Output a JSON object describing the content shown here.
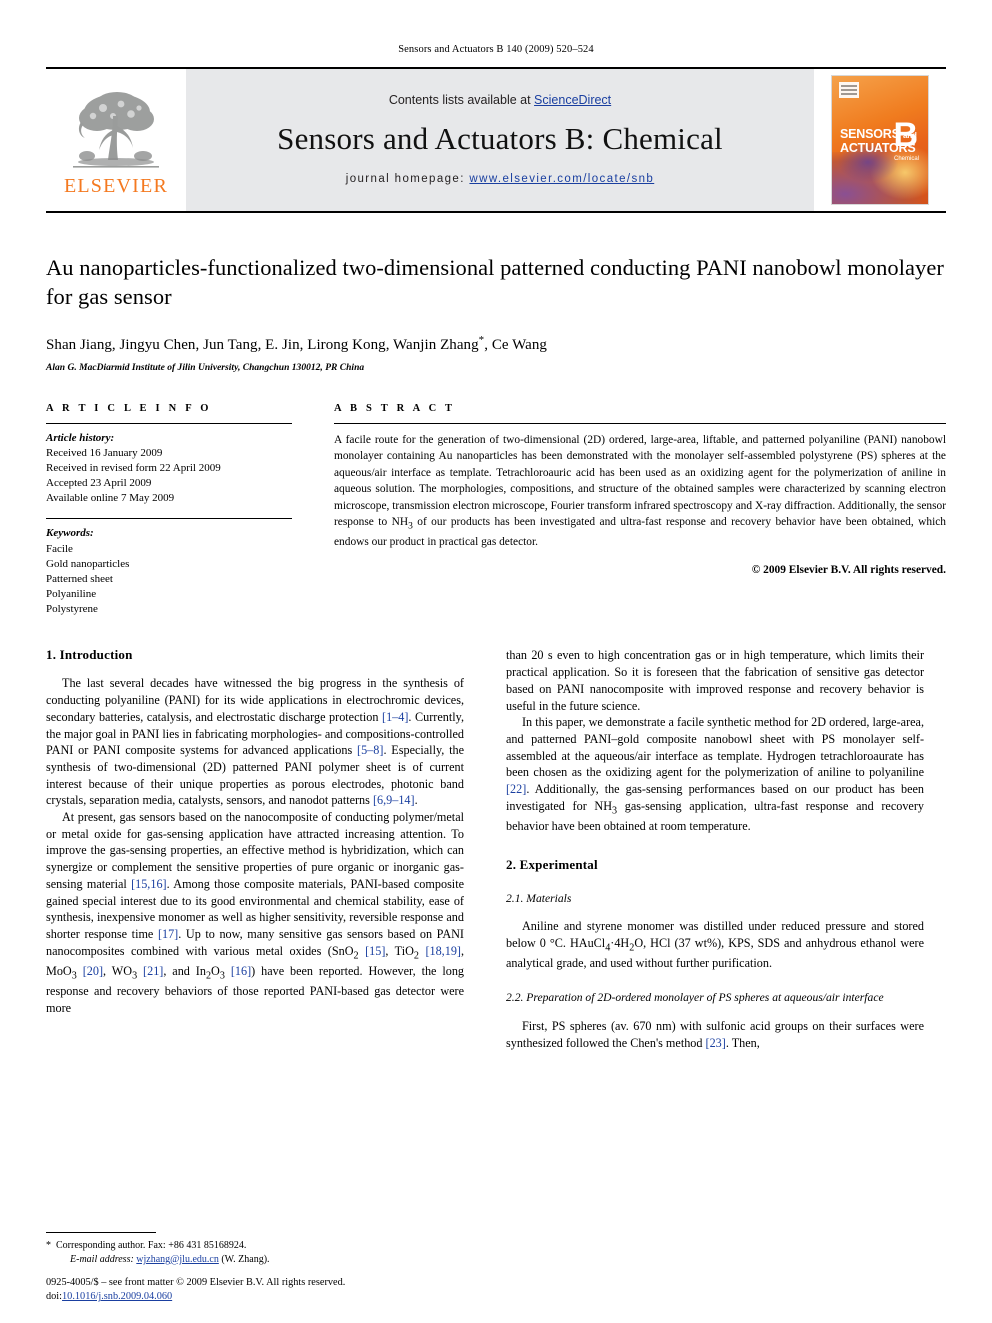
{
  "running_head": "Sensors and Actuators B 140 (2009) 520–524",
  "masthead": {
    "publisher_logo_label": "ELSEVIER",
    "contents_prefix": "Contents lists available at ",
    "contents_link": "ScienceDirect",
    "journal_title": "Sensors and Actuators B: Chemical",
    "homepage_prefix": "journal homepage: ",
    "homepage_url": "www.elsevier.com/locate/snb",
    "cover": {
      "line1": "SENSORS",
      "line1_small": "and",
      "line2": "ACTUATORS",
      "letter": "B",
      "sub": "Chemical"
    }
  },
  "article": {
    "title": "Au nanoparticles-functionalized two-dimensional patterned conducting PANI nanobowl monolayer for gas sensor",
    "authors": "Shan Jiang, Jingyu Chen, Jun Tang, E. Jin, Lirong Kong, Wanjin Zhang",
    "authors_star": "*",
    "authors_tail": ", Ce Wang",
    "affiliation": "Alan G. MacDiarmid Institute of Jilin University, Changchun 130012, PR China"
  },
  "info": {
    "heading": "A R T I C L E    I N F O",
    "history_label": "Article history:",
    "history": [
      "Received 16 January 2009",
      "Received in revised form 22 April 2009",
      "Accepted 23 April 2009",
      "Available online 7 May 2009"
    ],
    "keywords_label": "Keywords:",
    "keywords": [
      "Facile",
      "Gold nanoparticles",
      "Patterned sheet",
      "Polyaniline",
      "Polystyrene"
    ]
  },
  "abstract": {
    "heading": "A B S T R A C T",
    "text_part1": "A facile route for the generation of two-dimensional (2D) ordered, large-area, liftable, and patterned polyaniline (PANI) nanobowl monolayer containing Au nanoparticles has been demonstrated with the monolayer self-assembled polystyrene (PS) spheres at the aqueous/air interface as template. Tetrachloroauric acid has been used as an oxidizing agent for the polymerization of aniline in aqueous solution. The morphologies, compositions, and structure of the obtained samples were characterized by scanning electron microscope, transmission electron microscope, Fourier transform infrared spectroscopy and X-ray diffraction. Additionally, the sensor response to NH",
    "text_sub": "3",
    "text_part2": " of our products has been investigated and ultra-fast response and recovery behavior have been obtained, which endows our product in practical gas detector.",
    "copyright": "© 2009 Elsevier B.V. All rights reserved."
  },
  "sections": {
    "introduction_heading": "1.  Introduction",
    "experimental_heading": "2.  Experimental",
    "materials_heading": "2.1.  Materials",
    "prep_heading": "2.2.  Preparation of 2D-ordered monolayer of PS spheres at aqueous/air interface"
  },
  "body": {
    "intro_p1_a": "The last several decades have witnessed the big progress in the synthesis of conducting polyaniline (PANI) for its wide applications in electrochromic devices, secondary batteries, catalysis, and electrostatic discharge protection ",
    "intro_p1_c1": "[1–4]",
    "intro_p1_b": ". Currently, the major goal in PANI lies in fabricating morphologies- and compositions-controlled PANI or PANI composite systems for advanced applications ",
    "intro_p1_c2": "[5–8]",
    "intro_p1_c": ". Especially, the synthesis of two-dimensional (2D) patterned PANI polymer sheet is of current interest because of their unique properties as porous electrodes, photonic band crystals, separation media, catalysts, sensors, and nanodot patterns ",
    "intro_p1_c3": "[6,9–14]",
    "intro_p1_d": ".",
    "intro_p2_a": "At present, gas sensors based on the nanocomposite of conducting polymer/metal or metal oxide for gas-sensing application have attracted increasing attention. To improve the gas-sensing properties, an effective method is hybridization, which can synergize or complement the sensitive properties of pure organic or inorganic gas-sensing material ",
    "intro_p2_c1": "[15,16]",
    "intro_p2_b": ". Among those composite materials, PANI-based composite gained special interest due to its good environmental and chemical stability, ease of synthesis, inexpensive monomer as well as higher sensitivity, reversible response and shorter response time ",
    "intro_p2_c2": "[17]",
    "intro_p2_c": ". Up to now, many sensitive gas sensors based on PANI nanocomposites combined with various metal oxides (SnO",
    "intro_p2_sub1": "2",
    "intro_p2_c3": "[15]",
    "intro_p2_d": ", TiO",
    "intro_p2_sub2": "2",
    "intro_p2_c4": "[18,19]",
    "intro_p2_e": ", MoO",
    "intro_p2_sub3": "3",
    "intro_p2_c5": "[20]",
    "intro_p2_f": ", WO",
    "intro_p2_sub4": "3",
    "intro_p2_c6": "[21]",
    "intro_p2_g": ", and In",
    "intro_p2_sub5": "2",
    "intro_p2_h": "O",
    "intro_p2_sub6": "3",
    "intro_p2_c7": "[16]",
    "intro_p2_i": ") have been reported. However, the long response and recovery behaviors of those reported PANI-based gas detector were more",
    "intro_p3_a": "than 20 s even to high concentration gas or in high temperature, which limits their practical application. So it is foreseen that the fabrication of sensitive gas detector based on PANI nanocomposite with improved response and recovery behavior is useful in the future science.",
    "intro_p4_a": "In this paper, we demonstrate a facile synthetic method for 2D ordered, large-area, and patterned PANI–gold composite nanobowl sheet with PS monolayer self-assembled at the aqueous/air interface as template. Hydrogen tetrachloroaurate has been chosen as the oxidizing agent for the polymerization of aniline to polyaniline ",
    "intro_p4_c1": "[22]",
    "intro_p4_b": ". Additionally, the gas-sensing performances based on our product has been investigated for NH",
    "intro_p4_sub": "3",
    "intro_p4_c": " gas-sensing application, ultra-fast response and recovery behavior have been obtained at room temperature.",
    "materials_a": "Aniline and styrene monomer was distilled under reduced pressure and stored below 0 °C. HAuCl",
    "materials_sub1": "4",
    "materials_b": "·4H",
    "materials_sub2": "2",
    "materials_c": "O, HCl (37 wt%), KPS, SDS and anhydrous ethanol were analytical grade, and used without further purification.",
    "prep_a": "First, PS spheres (av. 670 nm) with sulfonic acid groups on their surfaces were synthesized followed the Chen's method ",
    "prep_c1": "[23]",
    "prep_b": ". Then,"
  },
  "footnotes": {
    "star": "*",
    "corr_author": "Corresponding author. Fax: +86 431 85168924.",
    "email_label": "E-mail address:",
    "email": "wjzhang@jlu.edu.cn",
    "email_tail": " (W. Zhang).",
    "issn_line": "0925-4005/$ – see front matter © 2009 Elsevier B.V. All rights reserved.",
    "doi_label": "doi:",
    "doi": "10.1016/j.snb.2009.04.060"
  },
  "colors": {
    "link_blue": "#1a3fa0",
    "elsevier_orange": "#F47920",
    "banner_gray": "#e7e8ea"
  }
}
